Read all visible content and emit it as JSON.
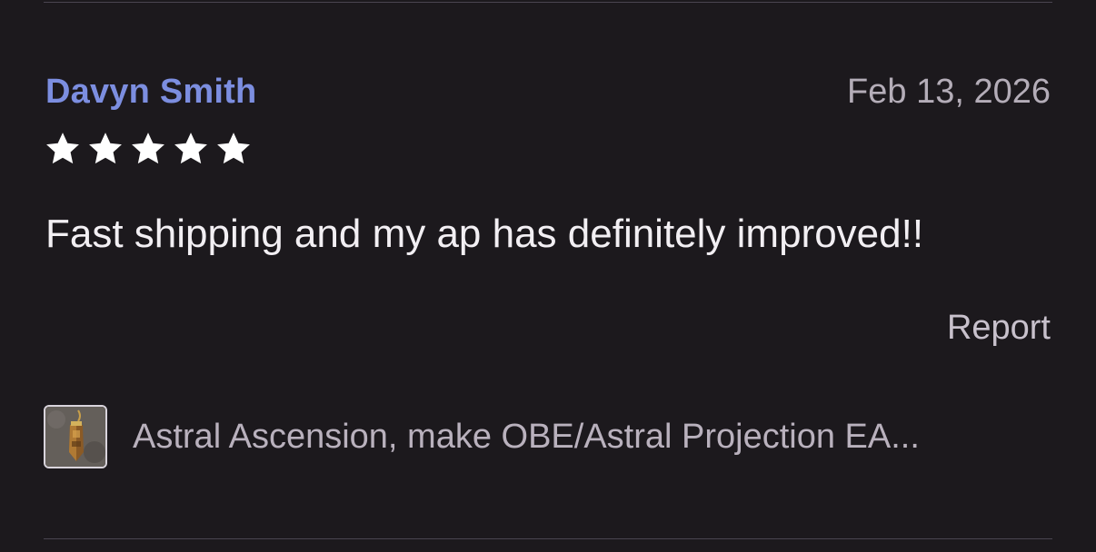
{
  "review": {
    "reviewer_name": "Davyn Smith",
    "date": "Feb 13, 2026",
    "rating": 5,
    "rating_max": 5,
    "text": "Fast shipping and my ap has definitely improved!!",
    "report_label": "Report"
  },
  "product": {
    "title": "Astral Ascension, make OBE/Astral Projection EA...",
    "thumbnail_icon": "crystal-pendant-thumbnail"
  },
  "colors": {
    "background": "#1c191d",
    "reviewer_name": "#7c8ee0",
    "star": "#ffffff",
    "body_text": "#f2eff3",
    "muted_text": "#b4adb8"
  }
}
